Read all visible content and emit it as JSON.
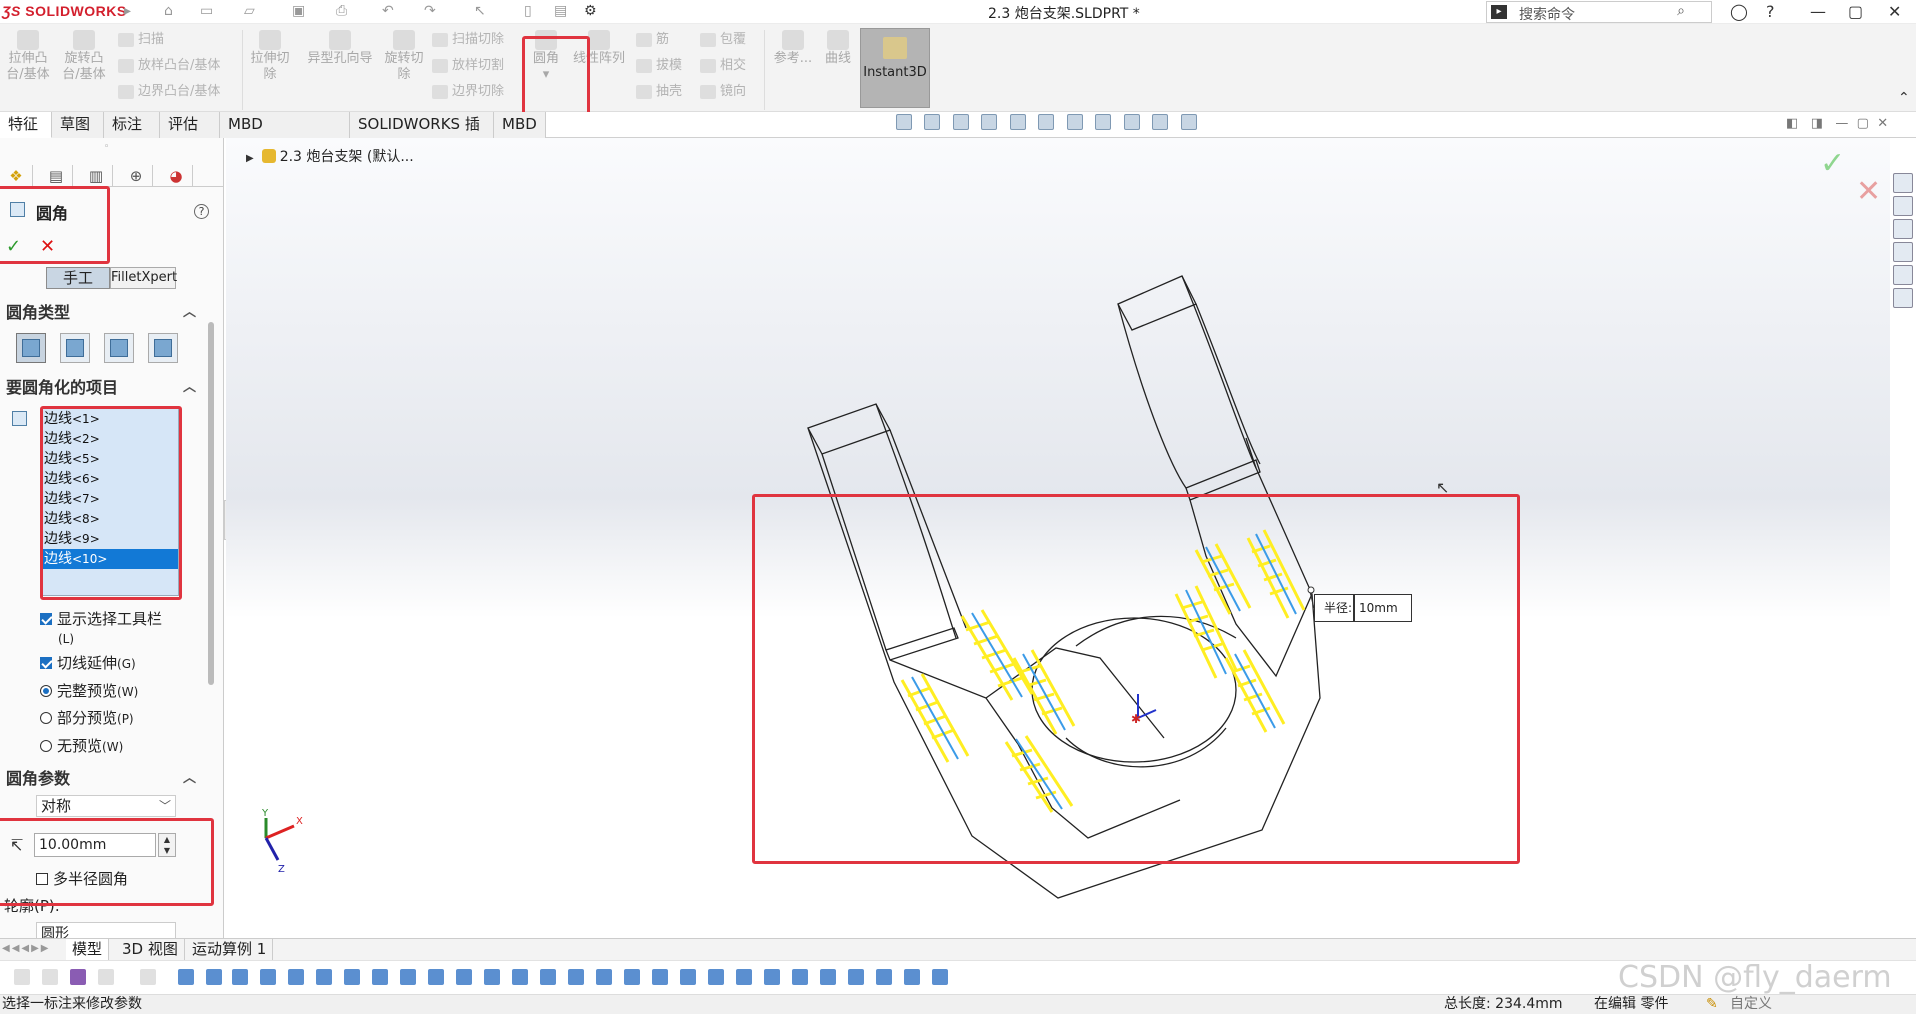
{
  "app": {
    "logo_ds": "ƷS",
    "logo_name": "SOLIDWORKS",
    "doc_title": "2.3 炮台支架.SLDPRT *"
  },
  "search": {
    "placeholder": "搜索命令"
  },
  "ribbon": {
    "extrude_boss": "拉伸凸\n台/基体",
    "revolve_boss": "旋转凸\n台/基体",
    "sweep": "扫描",
    "loft": "放样凸台/基体",
    "boundary_boss": "边界凸台/基体",
    "extrude_cut": "拉伸切\n除",
    "hole_wizard": "异型孔向导",
    "revolve_cut": "旋转切\n除",
    "sweep_cut": "扫描切除",
    "loft_cut": "放样切割",
    "boundary_cut": "边界切除",
    "fillet": "圆角",
    "linear_pattern": "线性阵列",
    "rib": "筋",
    "draft": "拔模",
    "shell": "抽壳",
    "wrap": "包覆",
    "intersect": "相交",
    "mirror": "镜向",
    "reference": "参考...",
    "curves": "曲线",
    "instant3d": "Instant3D"
  },
  "tabs": [
    {
      "label": "特征",
      "active": true
    },
    {
      "label": "草图"
    },
    {
      "label": "标注"
    },
    {
      "label": "评估"
    },
    {
      "label": "MBD Dimensions"
    },
    {
      "label": "SOLIDWORKS 插件"
    },
    {
      "label": "MBD"
    }
  ],
  "property_manager": {
    "title": "圆角",
    "help": "?",
    "ok": "✓",
    "cancel": "✕",
    "mode_manual": "手工",
    "mode_xpert": "FilletXpert",
    "section_type": "圆角类型",
    "section_items": "要圆角化的项目",
    "edges": [
      {
        "label": "边线",
        "num": "<1>"
      },
      {
        "label": "边线",
        "num": "<2>"
      },
      {
        "label": "边线",
        "num": "<5>"
      },
      {
        "label": "边线",
        "num": "<6>"
      },
      {
        "label": "边线",
        "num": "<7>"
      },
      {
        "label": "边线",
        "num": "<8>"
      },
      {
        "label": "边线",
        "num": "<9>"
      },
      {
        "label": "边线",
        "num": "<10>",
        "selected": true
      }
    ],
    "show_toolbar": "显示选择工具栏",
    "show_toolbar_key": "(L)",
    "tangent": "切线延伸",
    "tangent_key": "(G)",
    "full_preview": "完整预览",
    "full_preview_key": "(W)",
    "partial_preview": "部分预览",
    "partial_preview_key": "(P)",
    "no_preview": "无预览",
    "no_preview_key": "(W)",
    "section_params": "圆角参数",
    "symmetric": "对称",
    "radius": "10.00mm",
    "multi_radius": "多半径圆角",
    "profile": "轮廓(P):",
    "profile_value": "圆形"
  },
  "viewport": {
    "tree_root": "2.3 炮台支架 (默认...",
    "callout_label": "半径:",
    "callout_value": "10mm",
    "colors": {
      "fillet_preview": "#ffee22",
      "edge_highlight": "#3b9be8",
      "accent_red": "#e0343f"
    }
  },
  "bottom_tabs": [
    {
      "label": "模型",
      "active": true
    },
    {
      "label": "3D 视图"
    },
    {
      "label": "运动算例 1"
    }
  ],
  "status": {
    "hint": "选择一标注来修改参数",
    "total_length": "总长度: 234.4mm",
    "mode": "在编辑 零件",
    "custom": "自定义"
  },
  "watermark": "CSDN @fly_daerm"
}
